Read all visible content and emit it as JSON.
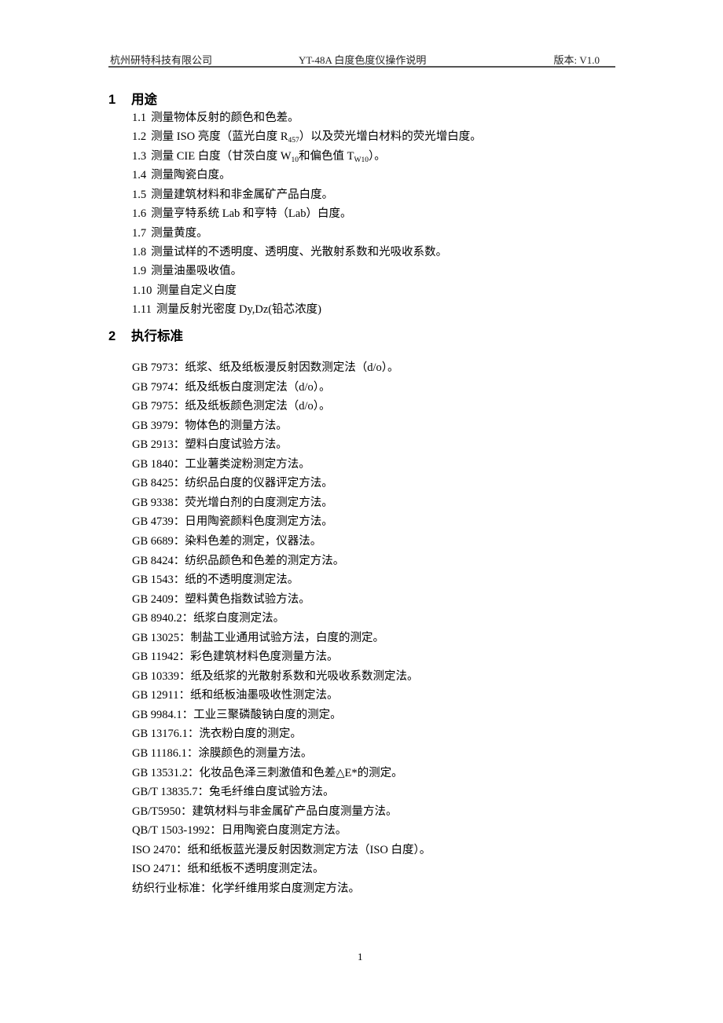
{
  "header": {
    "company": "杭州研特科技有限公司",
    "doc_title": "YT-48A 白度色度仪操作说明",
    "version": "版本:   V1.0"
  },
  "sections": [
    {
      "number": "1",
      "title": "用途",
      "items": [
        {
          "idx": "1.1",
          "text": "测量物体反射的颜色和色差。"
        },
        {
          "idx": "1.2",
          "pre": "测量 ISO 亮度（蓝光白度 R",
          "sub": "457",
          "post": "）以及荧光增白材料的荧光增白度。"
        },
        {
          "idx": "1.3",
          "pre": "测量 CIE 白度（甘茨白度 W",
          "sub": "10",
          "mid": "和偏色值 T",
          "sub2": "W10",
          "post": "）。"
        },
        {
          "idx": "1.4",
          "text": "测量陶瓷白度。"
        },
        {
          "idx": "1.5",
          "text": "测量建筑材料和非金属矿产品白度。"
        },
        {
          "idx": "1.6",
          "text": "测量亨特系统 Lab 和亨特（Lab）白度。"
        },
        {
          "idx": "1.7",
          "text": "测量黄度。"
        },
        {
          "idx": "1.8",
          "text": "测量试样的不透明度、透明度、光散射系数和光吸收系数。"
        },
        {
          "idx": "1.9",
          "text": "测量油墨吸收值。"
        },
        {
          "idx": "1.10",
          "text": "测量自定义白度"
        },
        {
          "idx": "1.11",
          "text": "测量反射光密度 Dy,Dz(铅芯浓度)"
        }
      ]
    },
    {
      "number": "2",
      "title": "执行标准",
      "standards": [
        "GB 7973：纸浆、纸及纸板漫反射因数测定法（d/o）。",
        "GB 7974：纸及纸板白度测定法（d/o）。",
        "GB 7975：纸及纸板颜色测定法（d/o）。",
        "GB 3979：物体色的测量方法。",
        "GB 2913：塑料白度试验方法。",
        "GB 1840：工业薯类淀粉测定方法。",
        "GB 8425：纺织品白度的仪器评定方法。",
        "GB 9338：荧光增白剂的白度测定方法。",
        "GB 4739：日用陶瓷颜料色度测定方法。",
        "GB 6689：染料色差的测定，仪器法。",
        "GB 8424：纺织品颜色和色差的测定方法。",
        "GB 1543：纸的不透明度测定法。",
        "GB 2409：塑料黄色指数试验方法。",
        "GB 8940.2：纸浆白度测定法。",
        "GB 13025：制盐工业通用试验方法，白度的测定。",
        "GB 11942：彩色建筑材料色度测量方法。",
        "GB 10339：纸及纸浆的光散射系数和光吸收系数测定法。",
        "GB 12911：纸和纸板油墨吸收性测定法。",
        "GB 9984.1：工业三聚磷酸钠白度的测定。",
        "GB 13176.1：洗衣粉白度的测定。",
        "GB 11186.1：涂膜颜色的测量方法。",
        "GB 13531.2：化妆品色泽三刺激值和色差△E*的测定。",
        "GB/T 13835.7：兔毛纤维白度试验方法。",
        "GB/T5950：建筑材料与非金属矿产品白度测量方法。",
        "QB/T 1503-1992：日用陶瓷白度测定方法。",
        "ISO 2470：纸和纸板蓝光漫反射因数测定方法（ISO 白度）。",
        "ISO 2471：纸和纸板不透明度测定法。",
        "纺织行业标准：化学纤维用浆白度测定方法。"
      ]
    }
  ],
  "footer": {
    "page_number": "1"
  }
}
